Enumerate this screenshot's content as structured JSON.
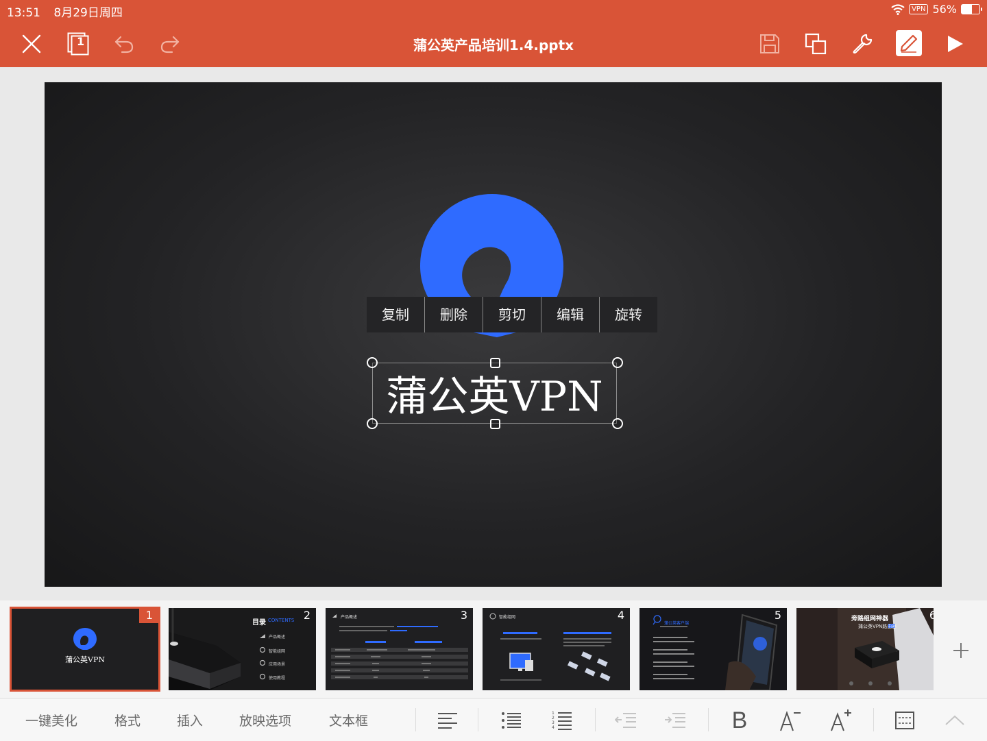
{
  "status_bar": {
    "time": "13:51",
    "date": "8月29日周四",
    "vpn_label": "VPN",
    "battery": "56%",
    "battery_level": 0.56
  },
  "header": {
    "title": "蒲公英产品培训1.4.pptx",
    "icons": [
      "close-icon",
      "slides-icon",
      "undo-icon",
      "redo-icon",
      "save-icon",
      "copy-icon",
      "wrench-icon",
      "pen-icon",
      "play-icon"
    ],
    "slides_icon_number": "1"
  },
  "colors": {
    "header": "#d95437",
    "logo_blue": "#2f6bff",
    "slide_bg": "#232325"
  },
  "slide": {
    "context_menu": [
      "复制",
      "删除",
      "剪切",
      "编辑",
      "旋转"
    ],
    "textbox_text": "蒲公英VPN"
  },
  "thumbnails": [
    {
      "number": "1",
      "caption": "蒲公英VPN",
      "selected": true
    },
    {
      "number": "2",
      "heading": "目录",
      "subheading": "CONTENTS",
      "items": [
        "产品概述",
        "智能组网",
        "应用场景",
        "使用教程"
      ]
    },
    {
      "number": "3",
      "heading": "产品概述"
    },
    {
      "number": "4",
      "heading": "智能组网"
    },
    {
      "number": "5",
      "heading": "蒲公英客户端"
    },
    {
      "number": "6",
      "heading": "旁路组网神器",
      "subheading": "蒲公英VPN路由器"
    }
  ],
  "bottom_toolbar": {
    "tabs": [
      "一键美化",
      "格式",
      "插入",
      "放映选项",
      "文本框"
    ],
    "icons": [
      "align-left-icon",
      "bullet-list-icon",
      "numbered-list-icon",
      "outdent-icon",
      "indent-icon",
      "bold-icon",
      "decrease-font-icon",
      "increase-font-icon",
      "textbox-settings-icon",
      "collapse-icon"
    ],
    "bold_label": "B"
  }
}
